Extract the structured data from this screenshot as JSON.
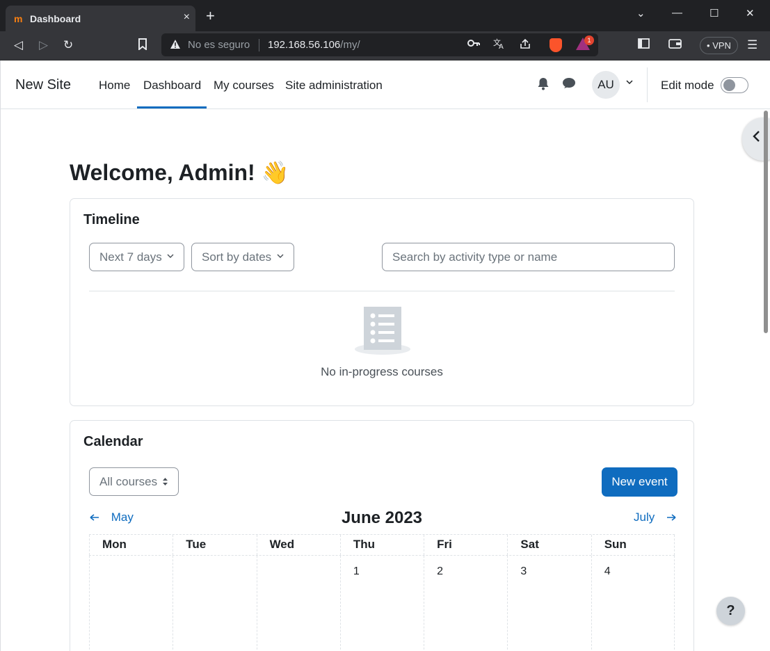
{
  "browser": {
    "tab_title": "Dashboard",
    "favicon_text": "m",
    "tab_close": "×",
    "new_tab": "+",
    "window_controls": {
      "dropdown": "⌄",
      "minimize": "—",
      "maximize": "☐",
      "close": "✕"
    },
    "nav": {
      "back": "◁",
      "forward": "▷",
      "reload": "↻",
      "bookmark": "🔖"
    },
    "security_text": "No es seguro",
    "url_host": "192.168.56.106",
    "url_path": "/my/",
    "rewards_badge": "1",
    "vpn_label": "VPN",
    "menu_icon": "☰"
  },
  "navbar": {
    "site_name": "New Site",
    "links": [
      "Home",
      "Dashboard",
      "My courses",
      "Site administration"
    ],
    "active_link": "Dashboard",
    "avatar_initials": "AU",
    "edit_mode_label": "Edit mode",
    "edit_mode_on": false
  },
  "page": {
    "welcome": "Welcome, Admin! 👋"
  },
  "timeline": {
    "title": "Timeline",
    "range_select": "Next 7 days",
    "sort_select": "Sort by dates",
    "search_placeholder": "Search by activity type or name",
    "empty_text": "No in-progress courses"
  },
  "calendar": {
    "title": "Calendar",
    "course_select": "All courses",
    "new_event": "New event",
    "prev_month": "May",
    "current_month": "June 2023",
    "next_month": "July",
    "weekdays": [
      "Mon",
      "Tue",
      "Wed",
      "Thu",
      "Fri",
      "Sat",
      "Sun"
    ],
    "first_week": [
      "",
      "",
      "",
      "1",
      "2",
      "3",
      "4"
    ]
  },
  "help_button": "?",
  "colors": {
    "primary": "#0f6cbf",
    "border": "#dee2e6",
    "text": "#1d2125"
  }
}
